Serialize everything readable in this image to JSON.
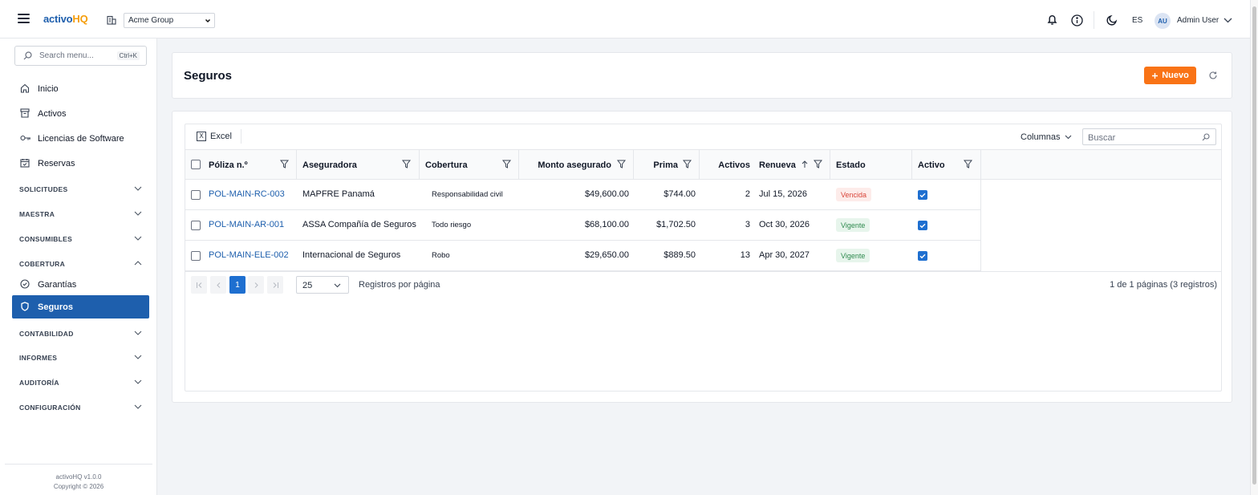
{
  "topbar": {
    "logo_part1": "activo",
    "logo_part2": "HQ",
    "company": "Acme Group",
    "lang": "ES",
    "avatar_initials": "AU",
    "user_name": "Admin User"
  },
  "sidebar": {
    "search_placeholder": "Search menu...",
    "search_shortcut": "Ctrl+K",
    "items": [
      {
        "label": "Inicio",
        "icon": "home-icon"
      },
      {
        "label": "Activos",
        "icon": "archive-icon"
      },
      {
        "label": "Licencias de Software",
        "icon": "key-icon"
      },
      {
        "label": "Reservas",
        "icon": "calendar-icon"
      }
    ],
    "sections": [
      "SOLICITUDES",
      "MAESTRA",
      "CONSUMIBLES",
      "COBERTURA",
      "CONTABILIDAD",
      "INFORMES",
      "AUDITORÍA",
      "CONFIGURACIÓN"
    ],
    "cobertura_items": [
      {
        "label": "Garantías",
        "icon": "check-circle-icon"
      },
      {
        "label": "Seguros",
        "icon": "shield-icon",
        "active": true
      }
    ],
    "footer_version": "activoHQ v1.0.0",
    "footer_copyright": "Copyright © 2026"
  },
  "page": {
    "title": "Seguros",
    "new_button": "Nuevo"
  },
  "grid": {
    "excel_label": "Excel",
    "columns_label": "Columnas",
    "search_placeholder": "Buscar",
    "headers": {
      "poliza": "Póliza n.º",
      "aseguradora": "Aseguradora",
      "cobertura": "Cobertura",
      "monto": "Monto asegurado",
      "prima": "Prima",
      "activos": "Activos",
      "renueva": "Renueva",
      "estado": "Estado",
      "activo": "Activo"
    },
    "rows": [
      {
        "poliza": "POL-MAIN-RC-003",
        "aseguradora": "MAPFRE Panamá",
        "cobertura": "Responsabilidad civil",
        "monto": "$49,600.00",
        "prima": "$744.00",
        "activos": "2",
        "renueva": "Jul 15, 2026",
        "estado": "Vencida",
        "activo": true
      },
      {
        "poliza": "POL-MAIN-AR-001",
        "aseguradora": "ASSA Compañía de Seguros",
        "cobertura": "Todo riesgo",
        "monto": "$68,100.00",
        "prima": "$1,702.50",
        "activos": "3",
        "renueva": "Oct 30, 2026",
        "estado": "Vigente",
        "activo": true
      },
      {
        "poliza": "POL-MAIN-ELE-002",
        "aseguradora": "Internacional de Seguros",
        "cobertura": "Robo",
        "monto": "$29,650.00",
        "prima": "$889.50",
        "activos": "13",
        "renueva": "Apr 30, 2027",
        "estado": "Vigente",
        "activo": true
      }
    ],
    "pager": {
      "current_page": "1",
      "page_size": "25",
      "page_size_label": "Registros por página",
      "info": "1 de 1 páginas (3 registros)"
    }
  },
  "colors": {
    "brand_blue": "#1e5fad",
    "brand_orange": "#f59e0b",
    "primary_button": "#f97316",
    "checkbox_blue": "#1e6fd0"
  }
}
